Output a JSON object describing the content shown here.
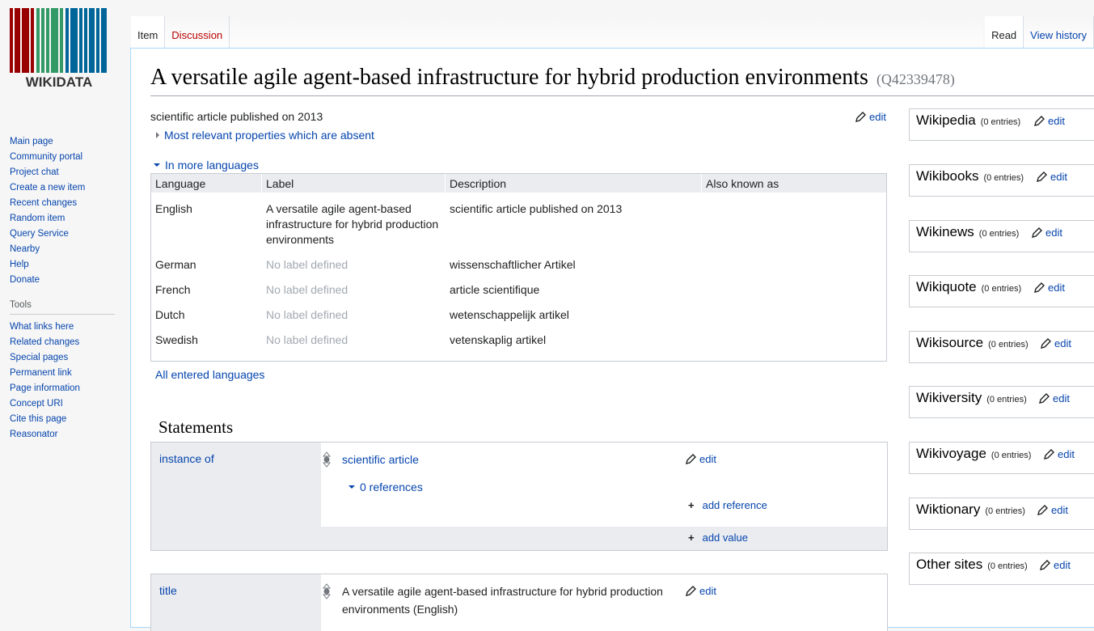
{
  "top_links": "",
  "sidebar": {
    "logo_text": "WIKIDATA",
    "nav": [
      "Main page",
      "Community portal",
      "Project chat",
      "Create a new item",
      "Recent changes",
      "Random item",
      "Query Service",
      "Nearby",
      "Help",
      "Donate"
    ],
    "tools_heading": "Tools",
    "tools": [
      "What links here",
      "Related changes",
      "Special pages",
      "Permanent link",
      "Page information",
      "Concept URI",
      "Cite this page",
      "Reasonator"
    ]
  },
  "tabs": {
    "item": "Item",
    "discussion": "Discussion",
    "read": "Read",
    "view_history": "View history"
  },
  "page": {
    "title": "A versatile agile agent-based infrastructure for hybrid production environments",
    "qid": "(Q42339478)",
    "description": "scientific article published on 2013",
    "edit_label": "edit",
    "relevant_props": "Most relevant properties which are absent",
    "in_more_languages": "In more languages",
    "all_entered_languages": "All entered languages",
    "statements_heading": "Statements"
  },
  "lang_table": {
    "headers": [
      "Language",
      "Label",
      "Description",
      "Also known as"
    ],
    "rows": [
      {
        "language": "English",
        "label": "A versatile agile agent-based infrastructure for hybrid production environments",
        "description": "scientific article published on 2013"
      },
      {
        "language": "German",
        "label": "No label defined",
        "description": "wissenschaftlicher Artikel"
      },
      {
        "language": "French",
        "label": "No label defined",
        "description": "article scientifique"
      },
      {
        "language": "Dutch",
        "label": "No label defined",
        "description": "wetenschappelijk artikel"
      },
      {
        "language": "Swedish",
        "label": "No label defined",
        "description": "vetenskaplig artikel"
      }
    ]
  },
  "statements": [
    {
      "property": "instance of",
      "value": "scientific article",
      "references": "0 references",
      "add_reference": "add reference",
      "add_value": "add value",
      "edit": "edit"
    },
    {
      "property": "title",
      "value": "A versatile agile agent-based infrastructure for hybrid production environments (English)",
      "edit": "edit"
    }
  ],
  "sitelinks": [
    {
      "name": "Wikipedia",
      "count": "(0 entries)",
      "edit": "edit"
    },
    {
      "name": "Wikibooks",
      "count": "(0 entries)",
      "edit": "edit"
    },
    {
      "name": "Wikinews",
      "count": "(0 entries)",
      "edit": "edit"
    },
    {
      "name": "Wikiquote",
      "count": "(0 entries)",
      "edit": "edit"
    },
    {
      "name": "Wikisource",
      "count": "(0 entries)",
      "edit": "edit"
    },
    {
      "name": "Wikiversity",
      "count": "(0 entries)",
      "edit": "edit"
    },
    {
      "name": "Wikivoyage",
      "count": "(0 entries)",
      "edit": "edit"
    },
    {
      "name": "Wiktionary",
      "count": "(0 entries)",
      "edit": "edit"
    },
    {
      "name": "Other sites",
      "count": "(0 entries)",
      "edit": "edit"
    }
  ],
  "colors": {
    "link": "#0645ad",
    "new_link": "#ba0000",
    "logo_red": "#990000",
    "logo_green": "#339966",
    "logo_blue": "#006699"
  }
}
